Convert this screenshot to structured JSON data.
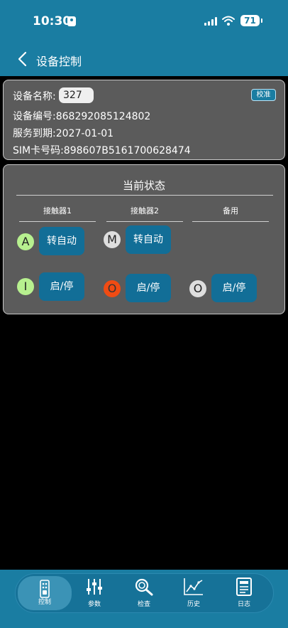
{
  "status_bar": {
    "time": "10:30",
    "battery": "71"
  },
  "nav": {
    "title": "设备控制"
  },
  "device": {
    "name_label": "设备名称:",
    "name_value": "327",
    "calibrate_label": "校准",
    "number": "设备编号:868292085124802",
    "expiry": "服务到期:2027-01-01",
    "sim": "SIM卡号码:898607B5161700628474"
  },
  "state": {
    "title": "当前状态",
    "columns": [
      "接触器1",
      "接触器2",
      "备用"
    ],
    "row1": [
      {
        "indicator": "A",
        "indicator_color": "#b7f08f",
        "button": "转自动"
      },
      {
        "indicator": "M",
        "indicator_color": "#dedede",
        "button": "转自动"
      }
    ],
    "row2": [
      {
        "indicator": "I",
        "indicator_color": "#b7f08f",
        "button": "启/停"
      },
      {
        "indicator": "O",
        "indicator_color": "#f04b13",
        "button": "启/停"
      },
      {
        "indicator": "O",
        "indicator_color": "#dedede",
        "button": "启/停"
      }
    ]
  },
  "tabs": [
    {
      "label": "控制",
      "icon": "remote-control-icon",
      "active": true
    },
    {
      "label": "参数",
      "icon": "sliders-icon",
      "active": false
    },
    {
      "label": "检查",
      "icon": "magnifier-icon",
      "active": false
    },
    {
      "label": "历史",
      "icon": "line-chart-icon",
      "active": false
    },
    {
      "label": "日志",
      "icon": "document-icon",
      "active": false
    }
  ],
  "colors": {
    "primary": "#1a7da2",
    "button": "#126e97",
    "card": "#5b5b5b"
  }
}
